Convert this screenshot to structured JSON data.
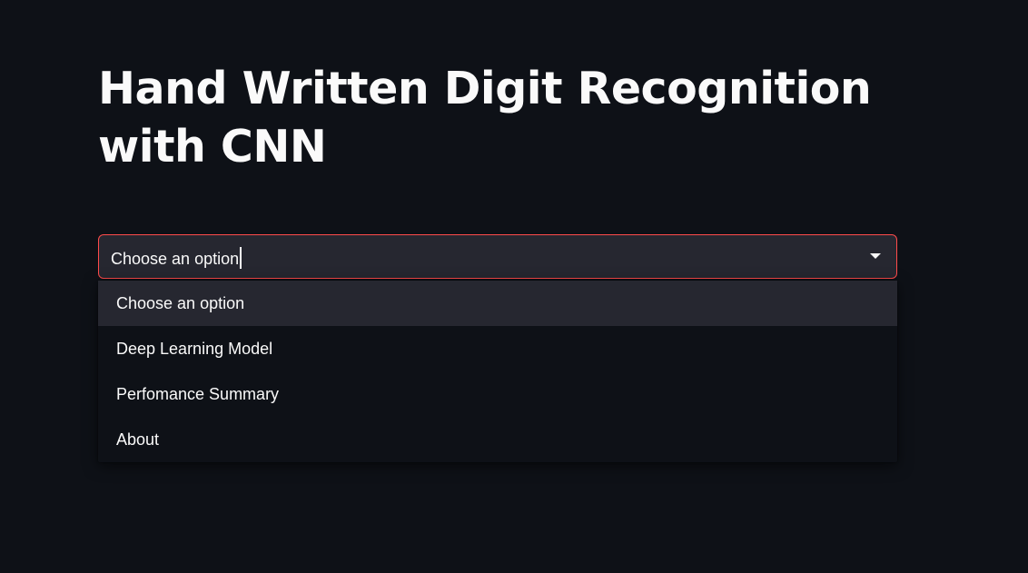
{
  "page": {
    "title": "Hand Written Digit Recognition with CNN"
  },
  "select": {
    "value": "Choose an option",
    "options": [
      {
        "label": "Choose an option",
        "highlighted": true
      },
      {
        "label": "Deep Learning Model",
        "highlighted": false
      },
      {
        "label": "Perfomance Summary",
        "highlighted": false
      },
      {
        "label": "About",
        "highlighted": false
      }
    ],
    "icon": "chevron-down-icon"
  },
  "colors": {
    "background": "#0e1117",
    "input_background": "#262730",
    "focus_border": "#ff4b4b",
    "text": "#fafafa"
  }
}
